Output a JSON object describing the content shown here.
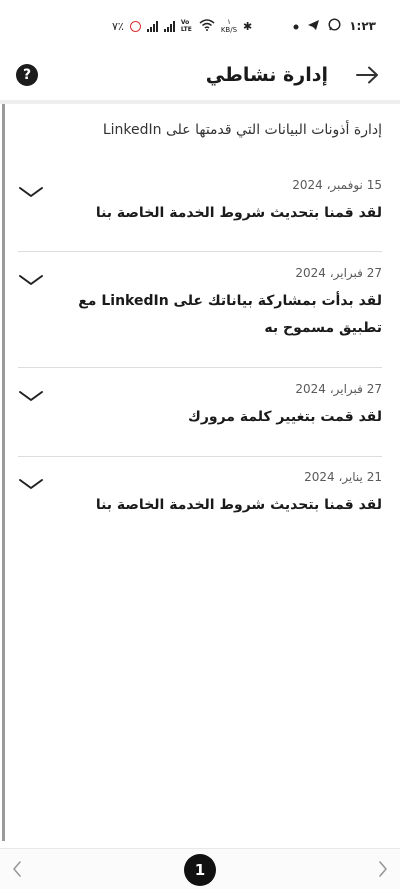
{
  "status_bar": {
    "time": "١:٢٣",
    "battery": "٧٪",
    "speed": "KB/S",
    "speed_value": "١",
    "volte": "Vo LTE"
  },
  "header": {
    "title": "إدارة نشاطي",
    "help_icon": "question-circle-icon",
    "back_icon": "arrow-right-icon"
  },
  "subtitle": "إدارة أذونات البيانات التي قدمتها على LinkedIn",
  "items": [
    {
      "date": "15 نوفمبر، 2024",
      "title": "لقد قمنا بتحديث شروط الخدمة الخاصة بنا"
    },
    {
      "date": "27 فبراير، 2024",
      "title": "لقد بدأت بمشاركة بياناتك على LinkedIn مع تطبيق مسموح به"
    },
    {
      "date": "27 فبراير، 2024",
      "title": "لقد قمت بتغيير كلمة مرورك"
    },
    {
      "date": "21 يناير، 2024",
      "title": "لقد قمنا بتحديث شروط الخدمة الخاصة بنا"
    }
  ],
  "pagination": {
    "current_page": "1"
  },
  "colors": {
    "accent": "#111111",
    "divider": "#dddddd",
    "rail": "#9a9a9a"
  }
}
